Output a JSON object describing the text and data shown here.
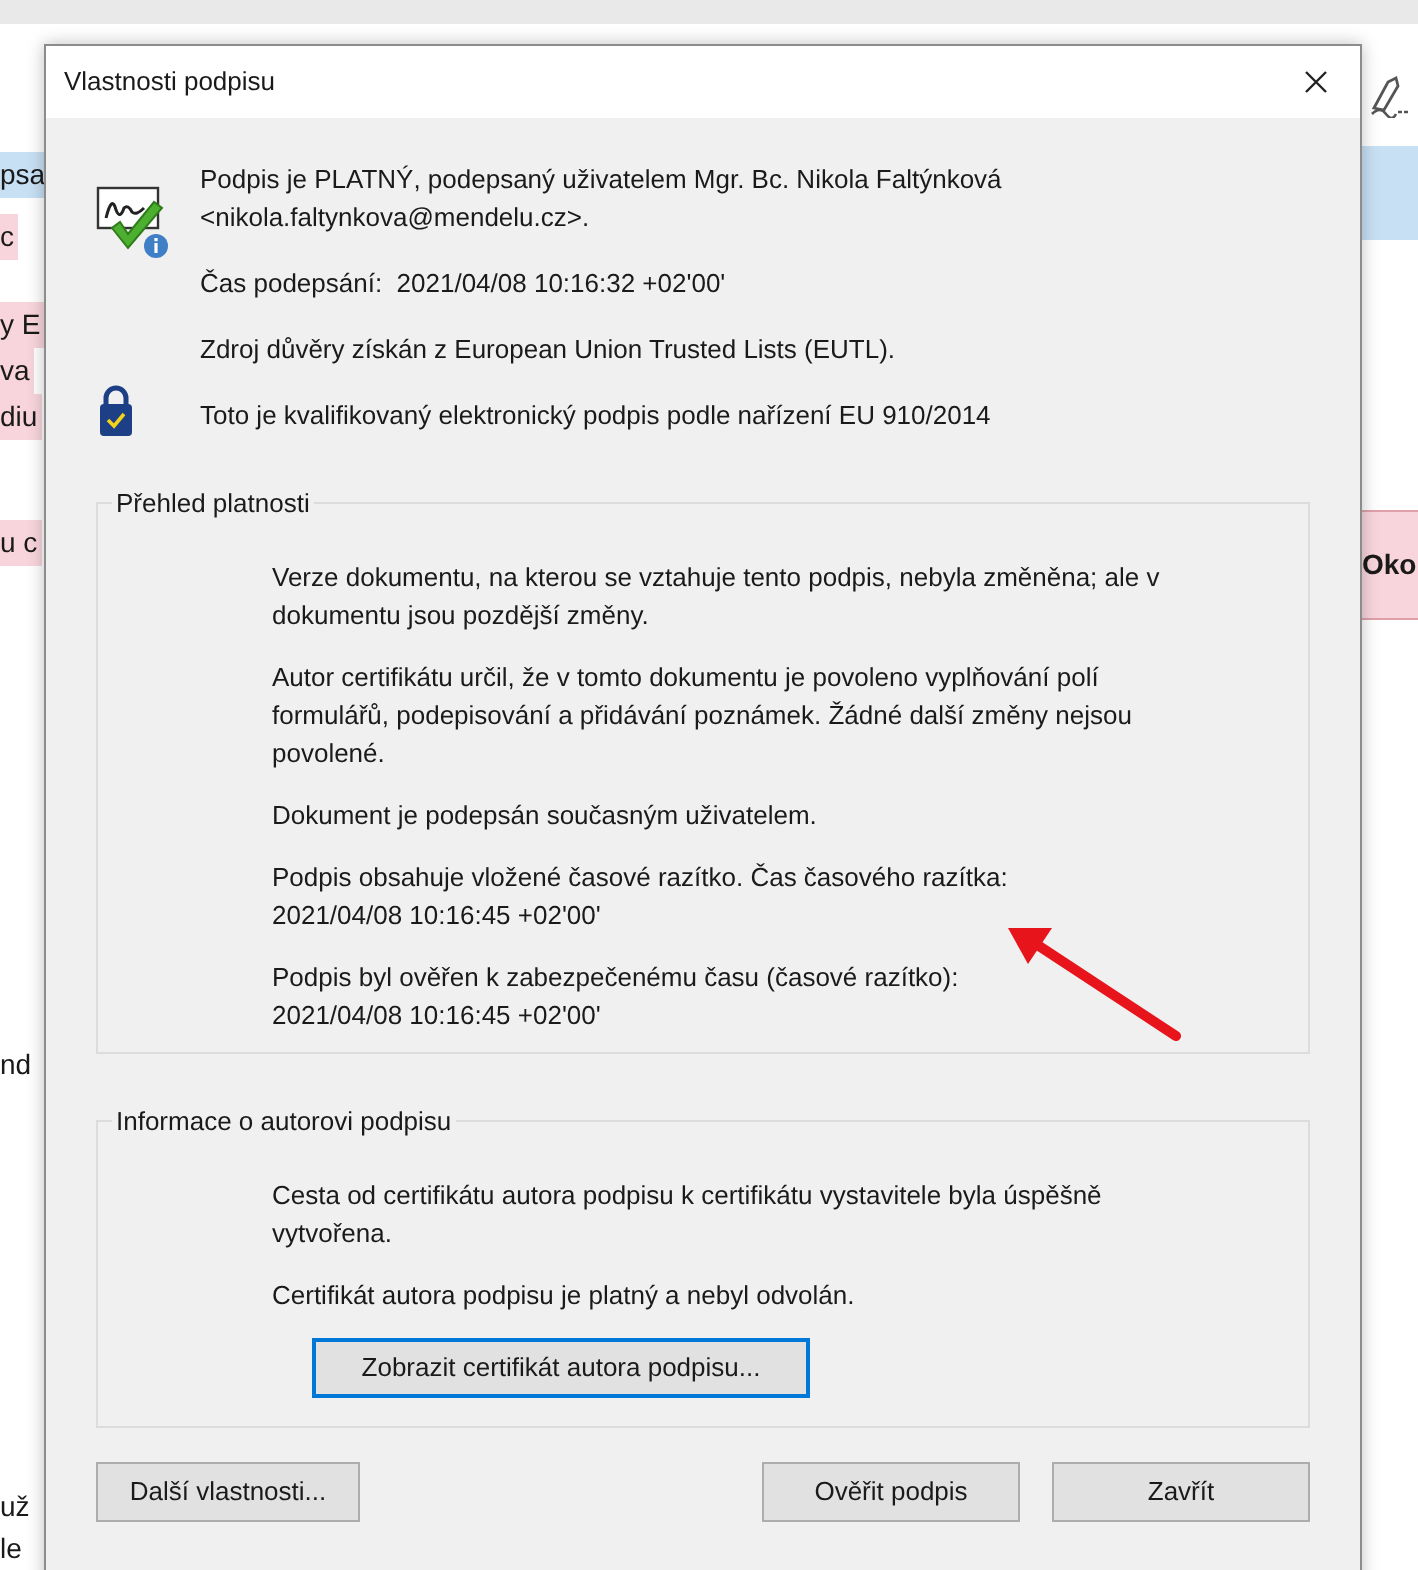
{
  "background": {
    "left_fragments": [
      {
        "text": "psa",
        "color": "#c7e0f4"
      },
      {
        "text": "c",
        "color": "#f8d5dc"
      },
      {
        "text": "y E",
        "color": "#f8d5dc"
      },
      {
        "text": "va",
        "color": "#f8d5dc"
      },
      {
        "text": "diu",
        "color": "#f8d5dc"
      },
      {
        "text": "u c",
        "color": "#f8d5dc"
      },
      {
        "text": "nd"
      },
      {
        "text": "už"
      },
      {
        "text": "le"
      }
    ],
    "right_fragments": [
      {
        "text": "Oko",
        "color": "#f8d5dc"
      }
    ]
  },
  "dialog": {
    "title": "Vlastnosti podpisu",
    "summary": [
      {
        "kind": "signature",
        "lines": [
          "Podpis je PLATNÝ, podepsaný uživatelem Mgr. Bc. Nikola Faltýnková\n<nikola.faltynkova@mendelu.cz>.",
          "Čas podepsání:  2021/04/08 10:16:32 +02'00'",
          "Zdroj důvěry získán z European Union Trusted Lists (EUTL)."
        ]
      },
      {
        "kind": "qualified",
        "lines": [
          "Toto je kvalifikovaný elektronický podpis podle nařízení EU 910/2014"
        ]
      }
    ],
    "sections": [
      {
        "legend": "Přehled platnosti",
        "paragraphs": [
          "Verze dokumentu, na kterou se vztahuje tento podpis, nebyla změněna; ale v\ndokumentu jsou pozdější změny.",
          "Autor certifikátu určil, že v tomto dokumentu je povoleno vyplňování polí\nformulářů, podepisování a přidávání poznámek. Žádné další změny nejsou\npovolené.",
          "Dokument je podepsán současným uživatelem.",
          "Podpis obsahuje vložené časové razítko. Čas časového razítka:\n2021/04/08 10:16:45 +02'00'",
          "Podpis byl ověřen k zabezpečenému času (časové razítko):\n2021/04/08 10:16:45 +02'00'"
        ]
      },
      {
        "legend": "Informace o autorovi podpisu",
        "paragraphs": [
          "Cesta od certifikátu autora podpisu k certifikátu vystavitele byla úspěšně\nvytvořena.",
          "Certifikát autora podpisu je platný a nebyl odvolán."
        ],
        "button": {
          "label": "Zobrazit certifikát autora podpisu...",
          "focused": true
        }
      }
    ],
    "buttons": [
      {
        "label": "Další vlastnosti...",
        "focused": false
      },
      {
        "label": "Ověřit podpis",
        "focused": false
      },
      {
        "label": "Zavřít",
        "focused": false
      }
    ]
  }
}
